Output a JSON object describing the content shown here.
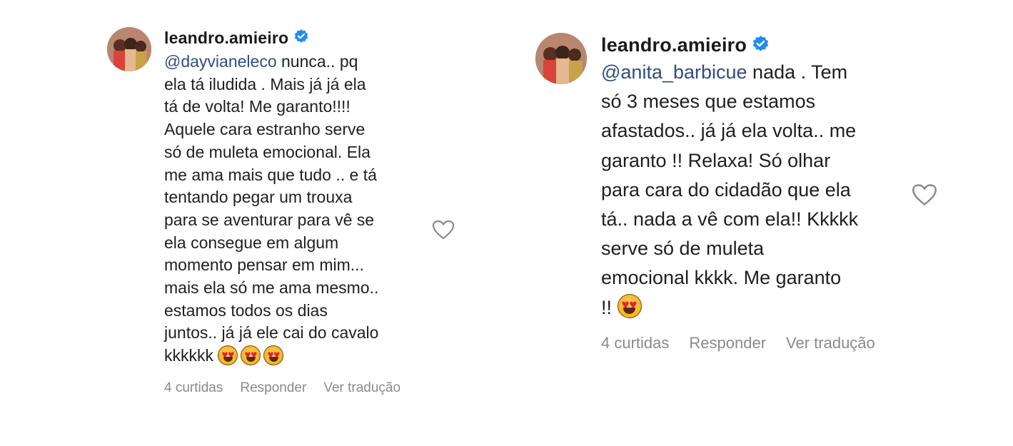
{
  "comments": [
    {
      "username": "leandro.amieiro",
      "verified": true,
      "mention": "@dayvianeleco",
      "lines": [
        " nunca.. pq",
        "ela tá iludida . Mais já já ela",
        "tá de volta! Me garanto!!!!",
        "Aquele cara estranho serve",
        "só de muleta emocional. Ela",
        "me ama mais que tudo .. e tá",
        "tentando pegar um trouxa",
        "para se aventurar para vê se",
        "ela consegue em algum",
        "momento pensar em mim...",
        "mais ela só me ama mesmo..",
        "estamos todos os dias",
        "juntos.. já já ele cai do cavalo",
        "kkkkkk "
      ],
      "emojis": [
        "heart-eyes-emoji",
        "heart-eyes-emoji",
        "heart-eyes-emoji"
      ],
      "likes": "4 curtidas",
      "reply_label": "Responder",
      "translate_label": "Ver tradução"
    },
    {
      "username": "leandro.amieiro",
      "verified": true,
      "mention": "@anita_barbicue",
      "lines": [
        " nada . Tem",
        "só 3 meses que estamos",
        "afastados.. já já ela volta.. me",
        "garanto !! Relaxa! Só olhar",
        "para cara do cidadão que ela",
        "tá.. nada a vê com ela!! Kkkkk",
        "serve só de muleta",
        "emocional kkkk. Me garanto",
        "!! "
      ],
      "emojis": [
        "heart-eyes-emoji"
      ],
      "likes": "4 curtidas",
      "reply_label": "Responder",
      "translate_label": "Ver tradução"
    }
  ],
  "colors": {
    "mention": "#2f4c86",
    "verified": "#1f8cf0",
    "meta": "#8a8a8a"
  }
}
